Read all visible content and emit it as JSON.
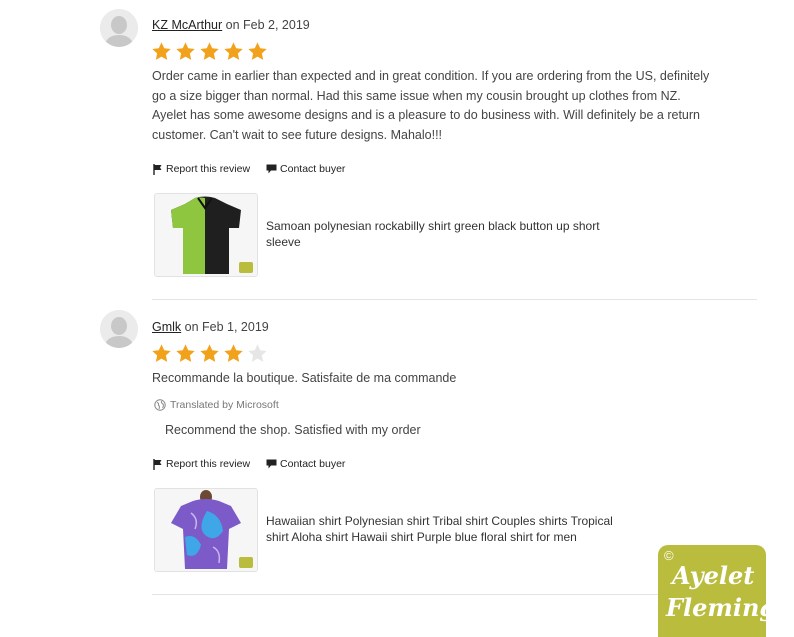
{
  "reviews": [
    {
      "username": "KZ McArthur",
      "date_text": " on Feb 2, 2019",
      "rating": 5,
      "text": "Order came in earlier than expected and in great condition. If you are ordering from the US, definitely go a size bigger than normal. Had this same issue when my cousin brought up clothes from NZ. Ayelet has some awesome designs and is a pleasure to do business with. Will definitely be a return customer. Can't wait to see future designs. Mahalo!!!",
      "report_label": "Report this review",
      "contact_label": "Contact buyer",
      "product_title": "Samoan polynesian rockabilly shirt green black button up short sleeve"
    },
    {
      "username": "Gmlk",
      "date_text": " on Feb 1, 2019",
      "rating": 4,
      "text": "Recommande la boutique. Satisfaite de ma commande",
      "translated_label": "Translated by Microsoft",
      "translation": "Recommend the shop. Satisfied with my order",
      "report_label": "Report this review",
      "contact_label": "Contact buyer",
      "product_title": "Hawaiian shirt Polynesian shirt Tribal shirt Couples shirts Tropical shirt Aloha shirt Hawaii shirt Purple blue floral shirt for men"
    }
  ],
  "watermark": {
    "copyright": "©",
    "line1": "Ayelet",
    "line2": "Fleming"
  },
  "colors": {
    "star_filled": "#f1a11a",
    "star_empty": "#e6e6e6",
    "watermark_bg": "#b9bc3d"
  }
}
